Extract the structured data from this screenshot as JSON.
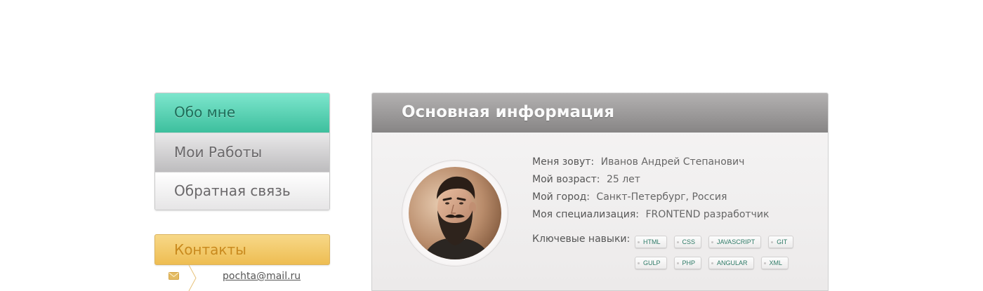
{
  "nav": {
    "items": [
      {
        "label": "Обо мне",
        "active": true
      },
      {
        "label": "Мои Работы",
        "active": false
      },
      {
        "label": "Обратная связь",
        "active": false
      }
    ]
  },
  "contacts": {
    "title": "Контакты",
    "email": "pochta@mail.ru",
    "icon": "envelope-icon"
  },
  "main": {
    "title": "Основная информация",
    "avatar_icon": "bearded-man-portrait",
    "info": [
      {
        "label": "Меня зовут:",
        "value": "Иванов Андрей Степанович"
      },
      {
        "label": "Мой возраст:",
        "value": "25 лет"
      },
      {
        "label": "Мой город:",
        "value": "Санкт-Петербург, Россия"
      },
      {
        "label": "Моя специализация:",
        "value": "FRONTEND разработчик"
      }
    ],
    "skills_label": "Ключевые навыки:",
    "skills": [
      "HTML",
      "CSS",
      "JAVASCRIPT",
      "GIT",
      "GULP",
      "PHP",
      "ANGULAR",
      "XML"
    ]
  },
  "colors": {
    "active_nav": "#3dbf9d",
    "contacts_accent": "#eebd52",
    "panel_header": "#878585",
    "skill_text": "#2d7a66"
  }
}
